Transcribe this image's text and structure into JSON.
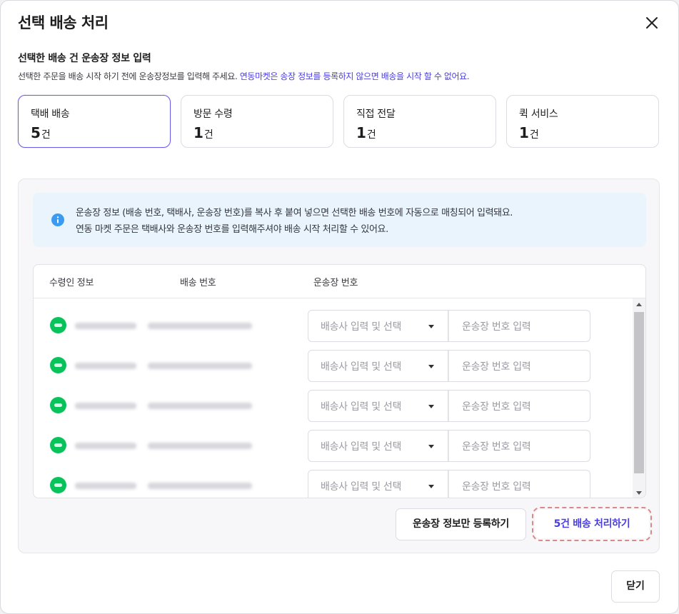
{
  "dialog": {
    "title": "선택 배송 처리",
    "close_icon": "close-icon"
  },
  "section": {
    "title": "선택한 배송 건 운송장 정보 입력",
    "desc_plain": "선택한 주문을 배송 시작 하기 전에 운송장정보를 입력해 주세요. ",
    "desc_accent": "연동마켓은 송장 정보를 등록하지 않으면 배송을 시작 할 수 없어요."
  },
  "stats": [
    {
      "label": "택배 배송",
      "count": "5",
      "unit": "건",
      "active": true
    },
    {
      "label": "방문 수령",
      "count": "1",
      "unit": "건",
      "active": false
    },
    {
      "label": "직접 전달",
      "count": "1",
      "unit": "건",
      "active": false
    },
    {
      "label": "퀵 서비스",
      "count": "1",
      "unit": "건",
      "active": false
    }
  ],
  "info": {
    "icon": "info-icon",
    "line1": "운송장 정보 (배송 번호, 택배사, 운송장 번호)를 복사 후 붙여 넣으면 선택한 배송 번호에 자동으로 매칭되어 입력돼요.",
    "line2": "연동 마켓 주문은 택배사와 운송장 번호를 입력해주셔야 배송 시작 처리할 수 있어요."
  },
  "table": {
    "headers": [
      "수령인 정보",
      "배송 번호",
      "운송장 번호"
    ],
    "courier_placeholder": "배송사 입력 및 선택",
    "tracking_placeholder": "운송장 번호 입력",
    "row_count": 5
  },
  "actions": {
    "register_only": "운송장 정보만 등록하기",
    "process": "5건 배송 처리하기",
    "close": "닫기"
  },
  "colors": {
    "accent": "#4a3ee0",
    "active_border": "#6c5ce7",
    "info_bg": "#eaf4fd",
    "info_icon": "#3b9bf0",
    "avatar": "#08c35a",
    "highlight_dash": "#d98989"
  }
}
